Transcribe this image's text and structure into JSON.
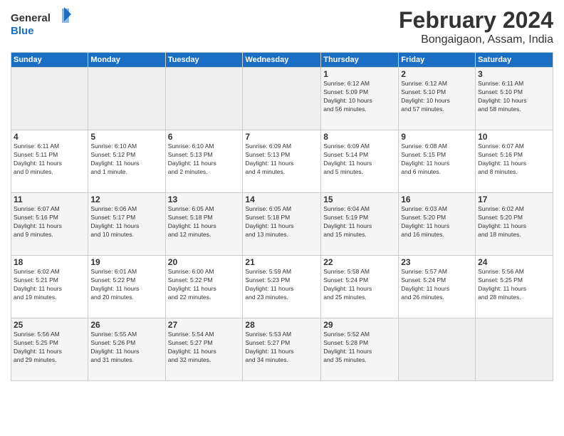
{
  "header": {
    "logo_line1": "General",
    "logo_line2": "Blue",
    "title": "February 2024",
    "subtitle": "Bongaigaon, Assam, India"
  },
  "calendar": {
    "days_of_week": [
      "Sunday",
      "Monday",
      "Tuesday",
      "Wednesday",
      "Thursday",
      "Friday",
      "Saturday"
    ],
    "weeks": [
      {
        "days": [
          {
            "num": "",
            "info": ""
          },
          {
            "num": "",
            "info": ""
          },
          {
            "num": "",
            "info": ""
          },
          {
            "num": "",
            "info": ""
          },
          {
            "num": "1",
            "info": "Sunrise: 6:12 AM\nSunset: 5:09 PM\nDaylight: 10 hours\nand 56 minutes."
          },
          {
            "num": "2",
            "info": "Sunrise: 6:12 AM\nSunset: 5:10 PM\nDaylight: 10 hours\nand 57 minutes."
          },
          {
            "num": "3",
            "info": "Sunrise: 6:11 AM\nSunset: 5:10 PM\nDaylight: 10 hours\nand 58 minutes."
          }
        ]
      },
      {
        "days": [
          {
            "num": "4",
            "info": "Sunrise: 6:11 AM\nSunset: 5:11 PM\nDaylight: 11 hours\nand 0 minutes."
          },
          {
            "num": "5",
            "info": "Sunrise: 6:10 AM\nSunset: 5:12 PM\nDaylight: 11 hours\nand 1 minute."
          },
          {
            "num": "6",
            "info": "Sunrise: 6:10 AM\nSunset: 5:13 PM\nDaylight: 11 hours\nand 2 minutes."
          },
          {
            "num": "7",
            "info": "Sunrise: 6:09 AM\nSunset: 5:13 PM\nDaylight: 11 hours\nand 4 minutes."
          },
          {
            "num": "8",
            "info": "Sunrise: 6:09 AM\nSunset: 5:14 PM\nDaylight: 11 hours\nand 5 minutes."
          },
          {
            "num": "9",
            "info": "Sunrise: 6:08 AM\nSunset: 5:15 PM\nDaylight: 11 hours\nand 6 minutes."
          },
          {
            "num": "10",
            "info": "Sunrise: 6:07 AM\nSunset: 5:16 PM\nDaylight: 11 hours\nand 8 minutes."
          }
        ]
      },
      {
        "days": [
          {
            "num": "11",
            "info": "Sunrise: 6:07 AM\nSunset: 5:16 PM\nDaylight: 11 hours\nand 9 minutes."
          },
          {
            "num": "12",
            "info": "Sunrise: 6:06 AM\nSunset: 5:17 PM\nDaylight: 11 hours\nand 10 minutes."
          },
          {
            "num": "13",
            "info": "Sunrise: 6:05 AM\nSunset: 5:18 PM\nDaylight: 11 hours\nand 12 minutes."
          },
          {
            "num": "14",
            "info": "Sunrise: 6:05 AM\nSunset: 5:18 PM\nDaylight: 11 hours\nand 13 minutes."
          },
          {
            "num": "15",
            "info": "Sunrise: 6:04 AM\nSunset: 5:19 PM\nDaylight: 11 hours\nand 15 minutes."
          },
          {
            "num": "16",
            "info": "Sunrise: 6:03 AM\nSunset: 5:20 PM\nDaylight: 11 hours\nand 16 minutes."
          },
          {
            "num": "17",
            "info": "Sunrise: 6:02 AM\nSunset: 5:20 PM\nDaylight: 11 hours\nand 18 minutes."
          }
        ]
      },
      {
        "days": [
          {
            "num": "18",
            "info": "Sunrise: 6:02 AM\nSunset: 5:21 PM\nDaylight: 11 hours\nand 19 minutes."
          },
          {
            "num": "19",
            "info": "Sunrise: 6:01 AM\nSunset: 5:22 PM\nDaylight: 11 hours\nand 20 minutes."
          },
          {
            "num": "20",
            "info": "Sunrise: 6:00 AM\nSunset: 5:22 PM\nDaylight: 11 hours\nand 22 minutes."
          },
          {
            "num": "21",
            "info": "Sunrise: 5:59 AM\nSunset: 5:23 PM\nDaylight: 11 hours\nand 23 minutes."
          },
          {
            "num": "22",
            "info": "Sunrise: 5:58 AM\nSunset: 5:24 PM\nDaylight: 11 hours\nand 25 minutes."
          },
          {
            "num": "23",
            "info": "Sunrise: 5:57 AM\nSunset: 5:24 PM\nDaylight: 11 hours\nand 26 minutes."
          },
          {
            "num": "24",
            "info": "Sunrise: 5:56 AM\nSunset: 5:25 PM\nDaylight: 11 hours\nand 28 minutes."
          }
        ]
      },
      {
        "days": [
          {
            "num": "25",
            "info": "Sunrise: 5:56 AM\nSunset: 5:25 PM\nDaylight: 11 hours\nand 29 minutes."
          },
          {
            "num": "26",
            "info": "Sunrise: 5:55 AM\nSunset: 5:26 PM\nDaylight: 11 hours\nand 31 minutes."
          },
          {
            "num": "27",
            "info": "Sunrise: 5:54 AM\nSunset: 5:27 PM\nDaylight: 11 hours\nand 32 minutes."
          },
          {
            "num": "28",
            "info": "Sunrise: 5:53 AM\nSunset: 5:27 PM\nDaylight: 11 hours\nand 34 minutes."
          },
          {
            "num": "29",
            "info": "Sunrise: 5:52 AM\nSunset: 5:28 PM\nDaylight: 11 hours\nand 35 minutes."
          },
          {
            "num": "",
            "info": ""
          },
          {
            "num": "",
            "info": ""
          }
        ]
      }
    ]
  }
}
